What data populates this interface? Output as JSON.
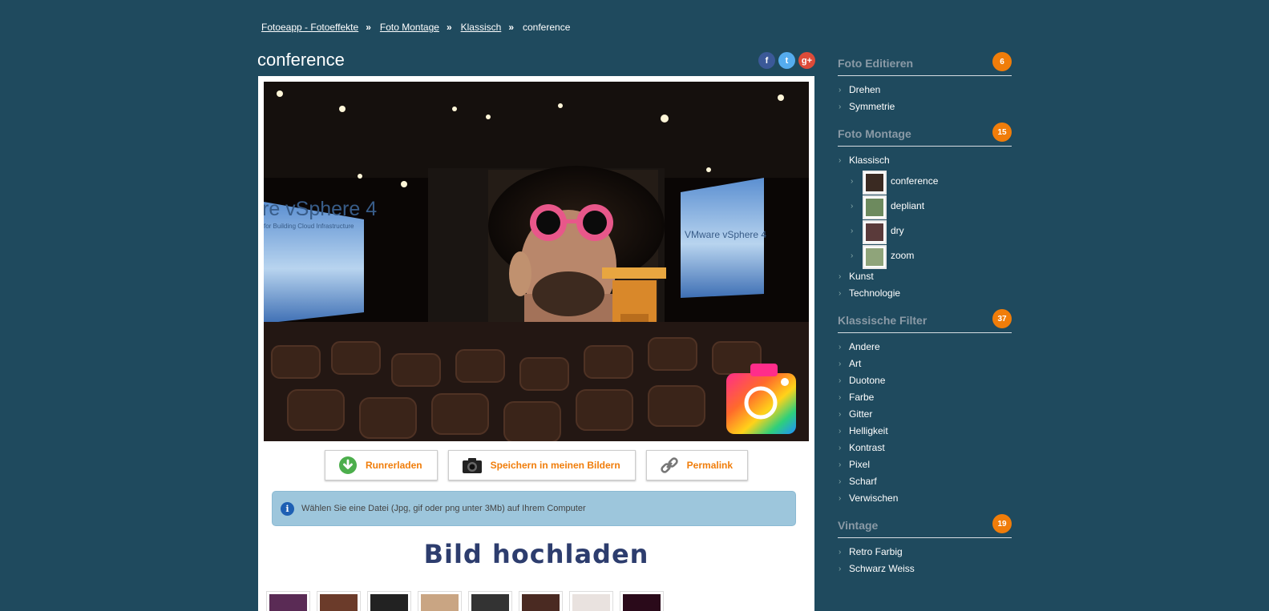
{
  "breadcrumb": {
    "items": [
      "Fotoeapp - Fotoeffekte",
      "Foto Montage",
      "Klassisch"
    ],
    "current": "conference",
    "separator": "»"
  },
  "page": {
    "title": "conference"
  },
  "social": {
    "facebook": "f",
    "twitter": "t",
    "google": "g+"
  },
  "toolbar": {
    "download": "Runrerladen",
    "save": "Speichern in meinen Bildern",
    "permalink": "Permalink"
  },
  "info": {
    "text": "Wählen Sie eine Datei (Jpg, gif oder png unter 3Mb) auf Ihrem Computer"
  },
  "upload": {
    "title": "Bild hochladen"
  },
  "photo": {
    "screen_left_text": "re vSphere 4",
    "screen_left_sub": "for Building Cloud Infrastructure",
    "screen_right_text": "VMware vSphere 4"
  },
  "sidebar": {
    "sections": [
      {
        "title": "Foto Editieren",
        "count": "6",
        "items": [
          "Drehen",
          "Symmetrie"
        ]
      },
      {
        "title": "Foto Montage",
        "count": "15",
        "items": [
          "Klassisch"
        ],
        "subitems": [
          "conference",
          "depliant",
          "dry",
          "zoom"
        ],
        "after": [
          "Kunst",
          "Technologie"
        ]
      },
      {
        "title": "Klassische Filter",
        "count": "37",
        "items": [
          "Andere",
          "Art",
          "Duotone",
          "Farbe",
          "Gitter",
          "Helligkeit",
          "Kontrast",
          "Pixel",
          "Scharf",
          "Verwischen"
        ]
      },
      {
        "title": "Vintage",
        "count": "19",
        "items": [
          "Retro Farbig",
          "Schwarz Weiss"
        ]
      }
    ]
  },
  "colors": {
    "background": "#1f4a5e",
    "accent": "#f07d0a",
    "info_bg": "#9dc6dc",
    "upload_title": "#2d3d6e"
  }
}
